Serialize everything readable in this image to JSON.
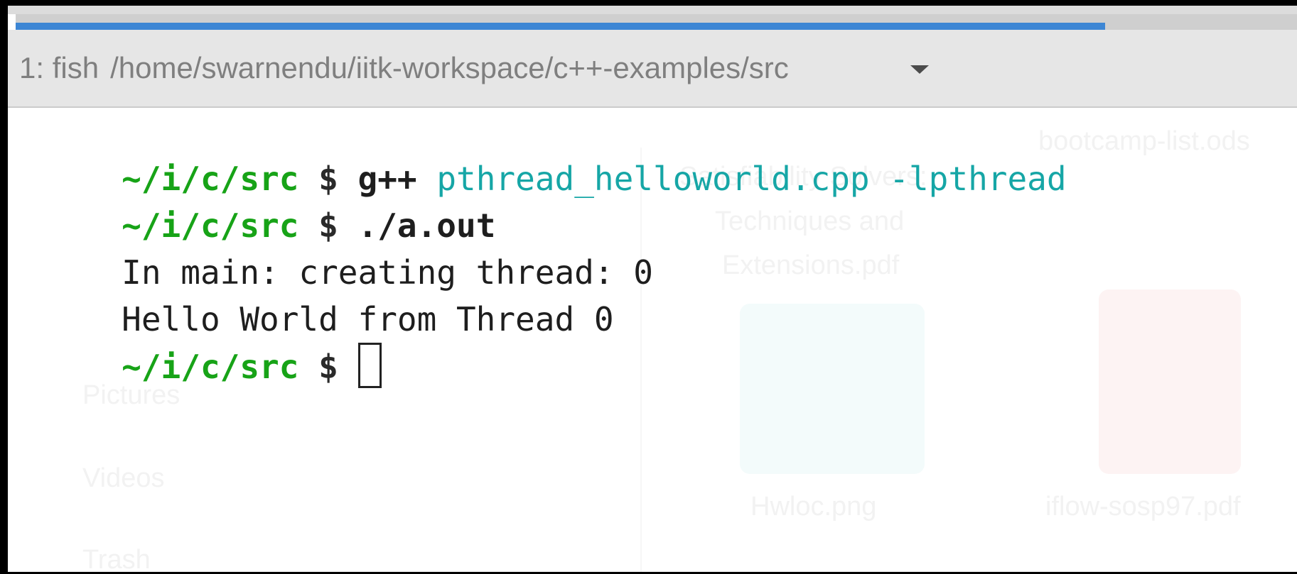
{
  "window": {
    "progress_percent": 85
  },
  "tab": {
    "index_label": "1: fish",
    "path": "/home/swarnendu/iitk-workspace/c++-examples/src",
    "menu_icon": "dropdown-arrow-icon"
  },
  "terminal": {
    "line1": {
      "prompt": "~/i/c/src",
      "dollar": "$",
      "command": "g++",
      "args": "pthread_helloworld.cpp -lpthread"
    },
    "line2": {
      "prompt": "~/i/c/src",
      "dollar": "$",
      "command": "./a.out"
    },
    "line3": {
      "output": "In main: creating thread: 0"
    },
    "line4": {
      "output": "Hello World from Thread 0"
    },
    "line5": {
      "prompt": "~/i/c/src",
      "dollar": "$"
    }
  },
  "background_file_manager": {
    "files": [
      "bootcamp-list.ods",
      "Satisfiability Solvers:",
      "Techniques and",
      "Extensions.pdf",
      "Hwloc.png",
      "iflow-sosp97.pdf"
    ],
    "sidebar": [
      "Pictures",
      "Videos",
      "Trash"
    ],
    "colors": {
      "image_icon": "#f3fbfb",
      "pdf_icon": "#fdf3f3"
    }
  },
  "colors": {
    "prompt": "#17a317",
    "argument": "#16a6a6",
    "progress": "#3d86d4",
    "tabbar": "#e6e6e6"
  }
}
